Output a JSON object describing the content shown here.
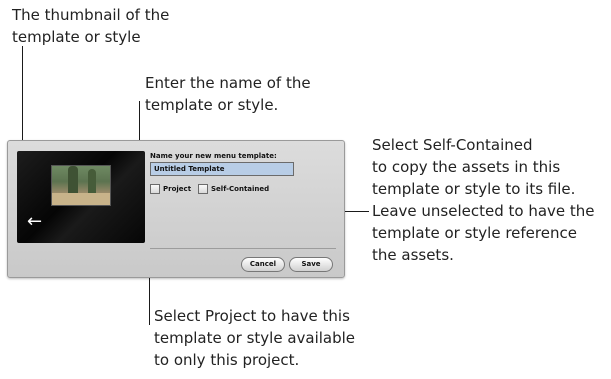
{
  "callouts": {
    "thumbnail": "The thumbnail of the\ntemplate or style",
    "name": "Enter the name of the\ntemplate or style.",
    "self_contained": "Select Self-Contained\nto copy the assets in this\ntemplate or style to its file.\nLeave unselected to have the\ntemplate or style reference\nthe assets.",
    "project": "Select Project to have this\ntemplate or style available\nto only this project."
  },
  "dialog": {
    "prompt": "Name your new menu template:",
    "name_value": "Untitled Template",
    "project_label": "Project",
    "project_checked": false,
    "self_contained_label": "Self-Contained",
    "self_contained_checked": false,
    "cancel_label": "Cancel",
    "save_label": "Save",
    "thumbnail_icon": "back-arrow-icon",
    "field_highlight_color": "#b8cde6"
  }
}
